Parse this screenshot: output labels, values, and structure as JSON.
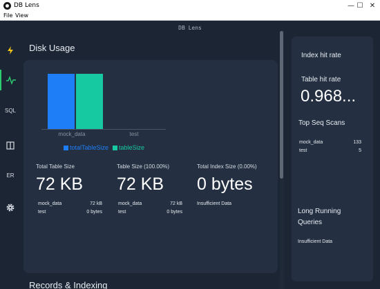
{
  "window": {
    "title": "DB Lens",
    "minimize": "—",
    "maximize": "☐",
    "close": "✕"
  },
  "menu": {
    "file": "File",
    "view": "View"
  },
  "app_header": "DB Lens",
  "sidebar": {
    "items": [
      {
        "label": "⚡",
        "icon": "lightning-icon"
      },
      {
        "label": "∿",
        "icon": "activity-icon"
      },
      {
        "label": "SQL"
      },
      {
        "label": "◫",
        "icon": "panel-icon"
      },
      {
        "label": "ER"
      },
      {
        "label": "⚙",
        "icon": "gear-icon"
      }
    ]
  },
  "disk_usage": {
    "title": "Disk Usage",
    "colors": {
      "totalTableSize": "#1e7ef7",
      "tableSize": "#17c9a0"
    },
    "chart_data": {
      "type": "bar",
      "categories": [
        "mock_data",
        "test"
      ],
      "series": [
        {
          "name": "totalTableSize",
          "values": [
            72,
            0
          ]
        },
        {
          "name": "tableSize",
          "values": [
            72,
            0
          ]
        }
      ],
      "ylim": [
        0,
        72
      ]
    },
    "stats": [
      {
        "label": "Total Table Size",
        "value": "72 KB",
        "rows": [
          {
            "name": "mock_data",
            "value": "72 kB"
          },
          {
            "name": "test",
            "value": "0 bytes"
          }
        ]
      },
      {
        "label": "Table Size (100.00%)",
        "value": "72 KB",
        "rows": [
          {
            "name": "mock_data",
            "value": "72 kB"
          },
          {
            "name": "test",
            "value": "0 bytes"
          }
        ]
      },
      {
        "label": "Total Index Size (0.00%)",
        "value": "0 bytes",
        "note": "Insufficient Data"
      }
    ]
  },
  "records_title": "Records & Indexing",
  "right_panel": {
    "index_hit_rate": "Index hit rate",
    "table_hit_rate": "Table hit rate",
    "table_hit_value": "0.968...",
    "top_seq_scans": "Top Seq Scans",
    "seq_rows": [
      {
        "name": "mock_data",
        "value": "133"
      },
      {
        "name": "test",
        "value": "5"
      }
    ],
    "long_running_queries": "Long Running Queries",
    "long_running_note": "Insufficient Data"
  }
}
